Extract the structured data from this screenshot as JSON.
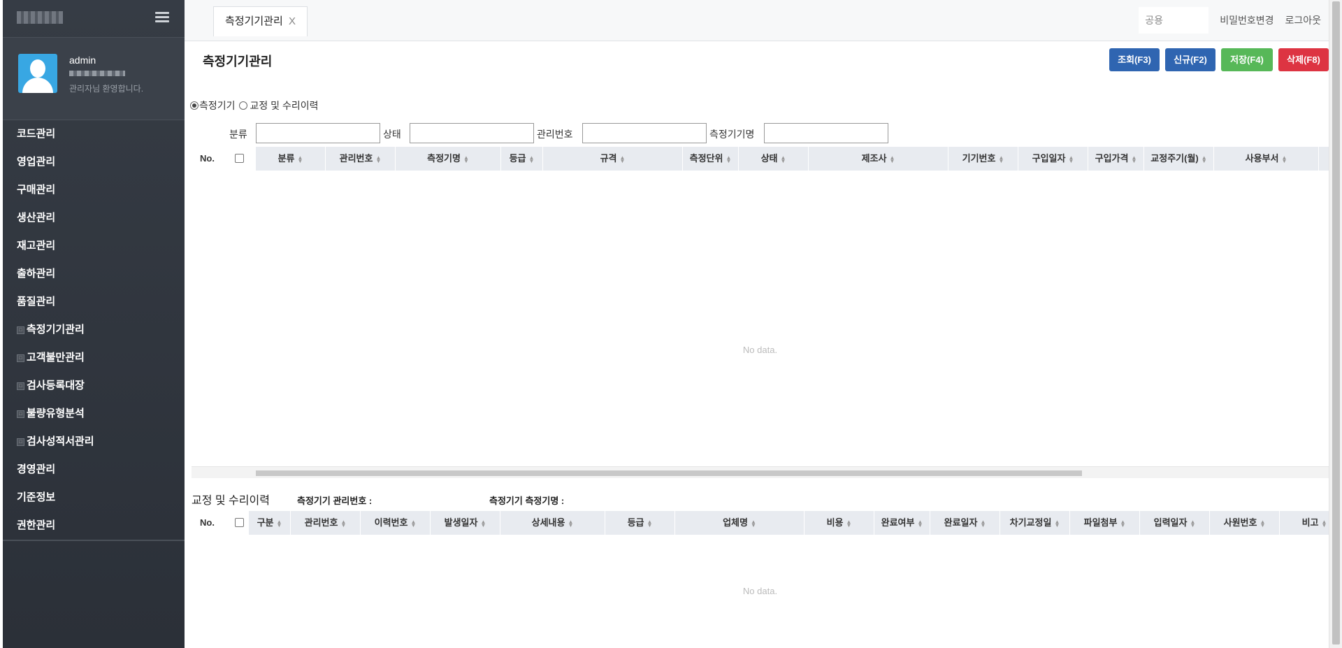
{
  "sidebar": {
    "profile": {
      "name": "admin",
      "welcome": "관리자님 환영합니다."
    },
    "menu": [
      {
        "label": "코드관리",
        "sub": false
      },
      {
        "label": "영업관리",
        "sub": false
      },
      {
        "label": "구매관리",
        "sub": false
      },
      {
        "label": "생산관리",
        "sub": false
      },
      {
        "label": "재고관리",
        "sub": false
      },
      {
        "label": "출하관리",
        "sub": false
      },
      {
        "label": "품질관리",
        "sub": false
      },
      {
        "label": "측정기기관리",
        "sub": true
      },
      {
        "label": "고객불만관리",
        "sub": true
      },
      {
        "label": "검사등록대장",
        "sub": true
      },
      {
        "label": "불량유형분석",
        "sub": true
      },
      {
        "label": "검사성적서관리",
        "sub": true
      },
      {
        "label": "경영관리",
        "sub": false
      },
      {
        "label": "기준정보",
        "sub": false
      },
      {
        "label": "권한관리",
        "sub": false
      }
    ]
  },
  "topbar": {
    "tab_label": "측정기기관리",
    "tab_close": "X",
    "shared": "공용",
    "change_password": "비밀번호변경",
    "logout": "로그아웃"
  },
  "main": {
    "title": "측정기기관리",
    "buttons": {
      "search": "조회(F3)",
      "new": "신규(F2)",
      "save": "저장(F4)",
      "delete": "삭제(F8)"
    },
    "radios": {
      "device": "측정기기",
      "history": "교정 및 수리이력"
    },
    "filters": {
      "category": "분류",
      "status": "상태",
      "mgmt_no": "관리번호",
      "device_name": "측정기기명"
    },
    "grid1": {
      "columns": [
        "No.",
        "분류",
        "관리번호",
        "측정기명",
        "등급",
        "규격",
        "측정단위",
        "상태",
        "제조사",
        "기기번호",
        "구입일자",
        "구입가격",
        "교정주기(월)",
        "사용부서"
      ],
      "empty": "No data."
    },
    "history": {
      "title": "교정 및 수리이력",
      "mgmt_no_label": "측정기기 관리번호 :",
      "name_label": "측정기기 측정기명 :"
    },
    "grid2": {
      "columns": [
        "No.",
        "구분",
        "관리번호",
        "이력번호",
        "발생일자",
        "상세내용",
        "등급",
        "업체명",
        "비용",
        "완료여부",
        "완료일자",
        "차기교정일",
        "파일첨부",
        "입력일자",
        "사원번호",
        "비고"
      ],
      "empty": "No data."
    }
  },
  "colors": {
    "sidebar": "#2f343c",
    "btn_blue": "#2f65b1",
    "btn_green": "#57b858",
    "btn_red": "#dd3442",
    "grid_header": "#e8ebf0"
  }
}
